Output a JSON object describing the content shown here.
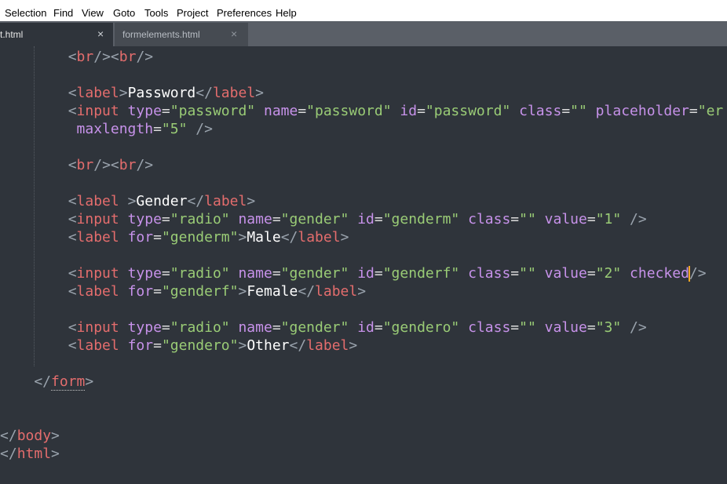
{
  "menubar": {
    "items": [
      "Selection",
      "Find",
      "View",
      "Goto",
      "Tools",
      "Project",
      "Preferences",
      "Help"
    ]
  },
  "tabs": [
    {
      "label": "t.html",
      "close": "×",
      "active": true
    },
    {
      "label": "formelements.html",
      "close": "×",
      "active": false
    }
  ],
  "code_lines": [
    [
      {
        "c": "p",
        "t": "        <"
      },
      {
        "c": "t",
        "t": "br"
      },
      {
        "c": "p",
        "t": "/><"
      },
      {
        "c": "t",
        "t": "br"
      },
      {
        "c": "p",
        "t": "/>"
      }
    ],
    [],
    [
      {
        "c": "p",
        "t": "        <"
      },
      {
        "c": "t",
        "t": "label"
      },
      {
        "c": "p",
        "t": ">"
      },
      {
        "c": "x",
        "t": "Password"
      },
      {
        "c": "p",
        "t": "</"
      },
      {
        "c": "t",
        "t": "label"
      },
      {
        "c": "p",
        "t": ">"
      }
    ],
    [
      {
        "c": "p",
        "t": "        <"
      },
      {
        "c": "t",
        "t": "input"
      },
      {
        "c": "a",
        "t": " type"
      },
      {
        "c": "o",
        "t": "="
      },
      {
        "c": "s",
        "t": "\"password\""
      },
      {
        "c": "a",
        "t": " name"
      },
      {
        "c": "o",
        "t": "="
      },
      {
        "c": "s",
        "t": "\"password\""
      },
      {
        "c": "a",
        "t": " id"
      },
      {
        "c": "o",
        "t": "="
      },
      {
        "c": "s",
        "t": "\"password\""
      },
      {
        "c": "a",
        "t": " class"
      },
      {
        "c": "o",
        "t": "="
      },
      {
        "c": "s",
        "t": "\"\""
      },
      {
        "c": "a",
        "t": " placeholder"
      },
      {
        "c": "o",
        "t": "="
      },
      {
        "c": "s",
        "t": "\"er"
      }
    ],
    [
      {
        "c": "a",
        "t": "         maxlength"
      },
      {
        "c": "o",
        "t": "="
      },
      {
        "c": "s",
        "t": "\"5\""
      },
      {
        "c": "p",
        "t": " />"
      }
    ],
    [],
    [
      {
        "c": "p",
        "t": "        <"
      },
      {
        "c": "t",
        "t": "br"
      },
      {
        "c": "p",
        "t": "/><"
      },
      {
        "c": "t",
        "t": "br"
      },
      {
        "c": "p",
        "t": "/>"
      }
    ],
    [],
    [
      {
        "c": "p",
        "t": "        <"
      },
      {
        "c": "t",
        "t": "label"
      },
      {
        "c": "p",
        "t": " >"
      },
      {
        "c": "x",
        "t": "Gender"
      },
      {
        "c": "p",
        "t": "</"
      },
      {
        "c": "t",
        "t": "label"
      },
      {
        "c": "p",
        "t": ">"
      }
    ],
    [
      {
        "c": "p",
        "t": "        <"
      },
      {
        "c": "t",
        "t": "input"
      },
      {
        "c": "a",
        "t": " type"
      },
      {
        "c": "o",
        "t": "="
      },
      {
        "c": "s",
        "t": "\"radio\""
      },
      {
        "c": "a",
        "t": " name"
      },
      {
        "c": "o",
        "t": "="
      },
      {
        "c": "s",
        "t": "\"gender\""
      },
      {
        "c": "a",
        "t": " id"
      },
      {
        "c": "o",
        "t": "="
      },
      {
        "c": "s",
        "t": "\"genderm\""
      },
      {
        "c": "a",
        "t": " class"
      },
      {
        "c": "o",
        "t": "="
      },
      {
        "c": "s",
        "t": "\"\""
      },
      {
        "c": "a",
        "t": " value"
      },
      {
        "c": "o",
        "t": "="
      },
      {
        "c": "s",
        "t": "\"1\""
      },
      {
        "c": "p",
        "t": " />"
      }
    ],
    [
      {
        "c": "p",
        "t": "        <"
      },
      {
        "c": "t",
        "t": "label"
      },
      {
        "c": "a",
        "t": " for"
      },
      {
        "c": "o",
        "t": "="
      },
      {
        "c": "s",
        "t": "\"genderm\""
      },
      {
        "c": "p",
        "t": ">"
      },
      {
        "c": "x",
        "t": "Male"
      },
      {
        "c": "p",
        "t": "</"
      },
      {
        "c": "t",
        "t": "label"
      },
      {
        "c": "p",
        "t": ">"
      }
    ],
    [],
    [
      {
        "c": "p",
        "t": "        <"
      },
      {
        "c": "t",
        "t": "input"
      },
      {
        "c": "a",
        "t": " type"
      },
      {
        "c": "o",
        "t": "="
      },
      {
        "c": "s",
        "t": "\"radio\""
      },
      {
        "c": "a",
        "t": " name"
      },
      {
        "c": "o",
        "t": "="
      },
      {
        "c": "s",
        "t": "\"gender\""
      },
      {
        "c": "a",
        "t": " id"
      },
      {
        "c": "o",
        "t": "="
      },
      {
        "c": "s",
        "t": "\"genderf\""
      },
      {
        "c": "a",
        "t": " class"
      },
      {
        "c": "o",
        "t": "="
      },
      {
        "c": "s",
        "t": "\"\""
      },
      {
        "c": "a",
        "t": " value"
      },
      {
        "c": "o",
        "t": "="
      },
      {
        "c": "s",
        "t": "\"2\""
      },
      {
        "c": "a",
        "t": " checked"
      },
      {
        "c": "cur",
        "t": ""
      },
      {
        "c": "p",
        "t": "/>"
      }
    ],
    [
      {
        "c": "p",
        "t": "        <"
      },
      {
        "c": "t",
        "t": "label"
      },
      {
        "c": "a",
        "t": " for"
      },
      {
        "c": "o",
        "t": "="
      },
      {
        "c": "s",
        "t": "\"genderf\""
      },
      {
        "c": "p",
        "t": ">"
      },
      {
        "c": "x",
        "t": "Female"
      },
      {
        "c": "p",
        "t": "</"
      },
      {
        "c": "t",
        "t": "label"
      },
      {
        "c": "p",
        "t": ">"
      }
    ],
    [],
    [
      {
        "c": "p",
        "t": "        <"
      },
      {
        "c": "t",
        "t": "input"
      },
      {
        "c": "a",
        "t": " type"
      },
      {
        "c": "o",
        "t": "="
      },
      {
        "c": "s",
        "t": "\"radio\""
      },
      {
        "c": "a",
        "t": " name"
      },
      {
        "c": "o",
        "t": "="
      },
      {
        "c": "s",
        "t": "\"gender\""
      },
      {
        "c": "a",
        "t": " id"
      },
      {
        "c": "o",
        "t": "="
      },
      {
        "c": "s",
        "t": "\"gendero\""
      },
      {
        "c": "a",
        "t": " class"
      },
      {
        "c": "o",
        "t": "="
      },
      {
        "c": "s",
        "t": "\"\""
      },
      {
        "c": "a",
        "t": " value"
      },
      {
        "c": "o",
        "t": "="
      },
      {
        "c": "s",
        "t": "\"3\""
      },
      {
        "c": "p",
        "t": " />"
      }
    ],
    [
      {
        "c": "p",
        "t": "        <"
      },
      {
        "c": "t",
        "t": "label"
      },
      {
        "c": "a",
        "t": " for"
      },
      {
        "c": "o",
        "t": "="
      },
      {
        "c": "s",
        "t": "\"gendero\""
      },
      {
        "c": "p",
        "t": ">"
      },
      {
        "c": "x",
        "t": "Other"
      },
      {
        "c": "p",
        "t": "</"
      },
      {
        "c": "t",
        "t": "label"
      },
      {
        "c": "p",
        "t": ">"
      }
    ],
    [],
    [
      {
        "c": "p",
        "t": "    </"
      },
      {
        "c": "tu",
        "t": "form"
      },
      {
        "c": "p",
        "t": ">"
      }
    ],
    [],
    [],
    [
      {
        "c": "p",
        "t": "</"
      },
      {
        "c": "t",
        "t": "body"
      },
      {
        "c": "p",
        "t": ">"
      }
    ],
    [
      {
        "c": "p",
        "t": "</"
      },
      {
        "c": "t",
        "t": "html"
      },
      {
        "c": "p",
        "t": ">"
      }
    ]
  ]
}
